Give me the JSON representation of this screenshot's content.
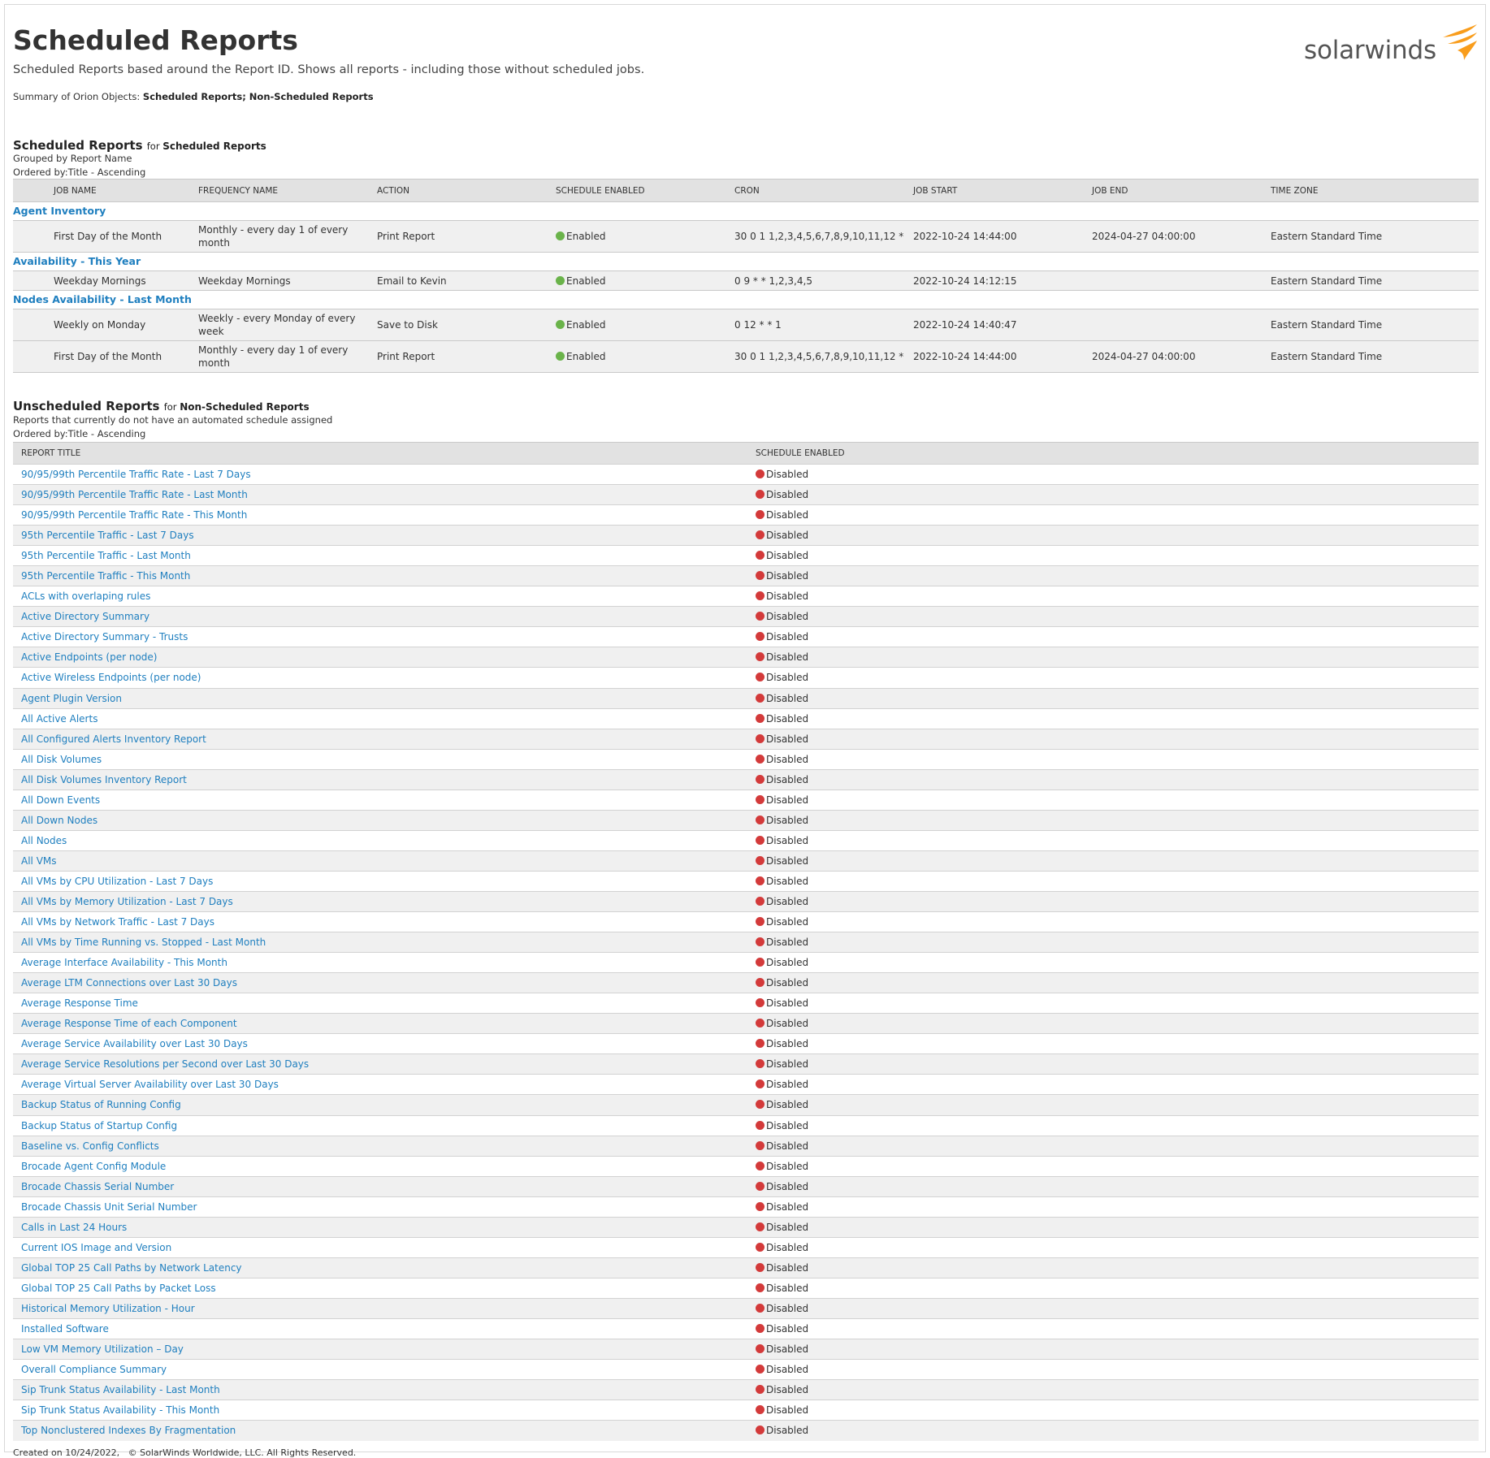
{
  "header": {
    "title": "Scheduled Reports",
    "subtitle": "Scheduled Reports based around the Report ID. Shows all reports - including those without scheduled jobs.",
    "summary_prefix": "Summary of Orion Objects:",
    "summary_objects": "Scheduled Reports; Non-Scheduled Reports",
    "logo_text": "solarwinds",
    "brand_color": "#f99d1c"
  },
  "scheduled": {
    "title": "Scheduled Reports",
    "for_word": "for",
    "for_target": "Scheduled Reports",
    "grouped_by": "Grouped by Report Name",
    "ordered_by": "Ordered by:Title - Ascending",
    "columns": [
      "JOB NAME",
      "FREQUENCY NAME",
      "ACTION",
      "SCHEDULE ENABLED",
      "CRON",
      "JOB START",
      "JOB END",
      "TIME ZONE"
    ],
    "groups": [
      {
        "name": "Agent Inventory",
        "rows": [
          {
            "job": "First Day of the Month",
            "freq": "Monthly - every day 1 of every month",
            "action": "Print Report",
            "enabled": "Enabled",
            "cron": "30 0 1 1,2,3,4,5,6,7,8,9,10,11,12 *",
            "start": "2022-10-24 14:44:00",
            "end": "2024-04-27 04:00:00",
            "tz": "Eastern Standard Time"
          }
        ]
      },
      {
        "name": "Availability - This Year",
        "rows": [
          {
            "job": "Weekday Mornings",
            "freq": "Weekday Mornings",
            "action": "Email to Kevin",
            "enabled": "Enabled",
            "cron": "0 9 * * 1,2,3,4,5",
            "start": "2022-10-24 14:12:15",
            "end": "",
            "tz": "Eastern Standard Time"
          }
        ]
      },
      {
        "name": "Nodes Availability - Last Month",
        "rows": [
          {
            "job": "Weekly on Monday",
            "freq": "Weekly - every Monday of every week",
            "action": "Save to Disk",
            "enabled": "Enabled",
            "cron": "0 12 * * 1",
            "start": "2022-10-24 14:40:47",
            "end": "",
            "tz": "Eastern Standard Time"
          },
          {
            "job": "First Day of the Month",
            "freq": "Monthly - every day 1 of every month",
            "action": "Print Report",
            "enabled": "Enabled",
            "cron": "30 0 1 1,2,3,4,5,6,7,8,9,10,11,12 *",
            "start": "2022-10-24 14:44:00",
            "end": "2024-04-27 04:00:00",
            "tz": "Eastern Standard Time"
          }
        ]
      }
    ]
  },
  "unscheduled": {
    "title": "Unscheduled Reports",
    "for_word": "for",
    "for_target": "Non-Scheduled Reports",
    "description": "Reports that currently do not have an automated schedule assigned",
    "ordered_by": "Ordered by:Title - Ascending",
    "columns": [
      "REPORT TITLE",
      "SCHEDULE ENABLED"
    ],
    "status": "Disabled",
    "reports": [
      "90/95/99th Percentile Traffic Rate - Last 7 Days",
      "90/95/99th Percentile Traffic Rate - Last Month",
      "90/95/99th Percentile Traffic Rate - This Month",
      "95th Percentile Traffic - Last 7 Days",
      "95th Percentile Traffic - Last Month",
      "95th Percentile Traffic - This Month",
      "ACLs with overlaping rules",
      "Active Directory Summary",
      "Active Directory Summary - Trusts",
      "Active Endpoints (per node)",
      "Active Wireless Endpoints (per node)",
      "Agent Plugin Version",
      "All Active Alerts",
      "All Configured Alerts Inventory Report",
      "All Disk Volumes",
      "All Disk Volumes Inventory Report",
      "All Down Events",
      "All Down Nodes",
      "All Nodes",
      "All VMs",
      "All VMs by CPU Utilization - Last 7 Days",
      "All VMs by Memory Utilization - Last 7 Days",
      "All VMs by Network Traffic - Last 7 Days",
      "All VMs by Time Running vs. Stopped - Last Month",
      "Average Interface Availability - This Month",
      "Average LTM Connections over Last 30 Days",
      "Average Response Time",
      "Average Response Time of each Component",
      "Average Service Availability over Last 30 Days",
      "Average Service Resolutions per Second over Last 30 Days",
      "Average Virtual Server Availability over Last 30 Days",
      "Backup Status of Running Config",
      "Backup Status of Startup Config",
      "Baseline vs. Config Conflicts",
      "Brocade Agent Config Module",
      "Brocade Chassis Serial Number",
      "Brocade Chassis Unit Serial Number",
      "Calls in Last 24 Hours",
      "Current IOS Image and Version",
      "Global TOP 25 Call Paths by Network Latency",
      "Global TOP 25 Call Paths by Packet Loss",
      "Historical Memory Utilization - Hour",
      "Installed Software",
      "Low VM Memory Utilization – Day",
      "Overall Compliance Summary",
      "Sip Trunk Status Availability - Last Month",
      "Sip Trunk Status Availability - This Month",
      "Top Nonclustered Indexes By Fragmentation"
    ]
  },
  "footer": {
    "created": "Created on 10/24/2022,",
    "copyright": "© SolarWinds Worldwide, LLC. All Rights Reserved."
  }
}
